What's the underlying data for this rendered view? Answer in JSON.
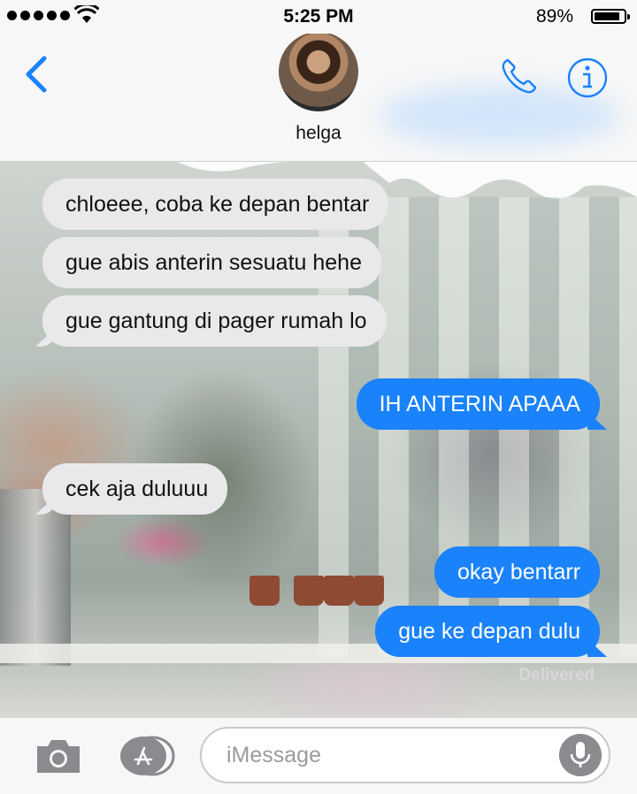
{
  "status_bar": {
    "time": "5:25 PM",
    "battery_percent": "89%",
    "signal_bars": 5,
    "wifi_icon": "wifi-icon"
  },
  "header": {
    "contact_name": "helga",
    "back_icon": "chevron-left-icon",
    "call_icon": "phone-icon",
    "info_icon": "info-icon"
  },
  "messages": [
    {
      "direction": "incoming",
      "text": "chloeee, coba ke depan bentar"
    },
    {
      "direction": "incoming",
      "text": "gue abis anterin sesuatu hehe"
    },
    {
      "direction": "incoming",
      "text": "gue gantung di pager rumah lo"
    },
    {
      "direction": "outgoing",
      "text": "IH ANTERIN APAAA"
    },
    {
      "direction": "incoming",
      "text": "cek aja duluuu"
    },
    {
      "direction": "outgoing",
      "text": "okay bentarr"
    },
    {
      "direction": "outgoing",
      "text": "gue ke depan dulu"
    }
  ],
  "delivery_status": "Delivered",
  "input_bar": {
    "placeholder": "iMessage",
    "camera_icon": "camera-icon",
    "apps_icon": "app-store-icon",
    "mic_icon": "microphone-icon"
  },
  "colors": {
    "accent": "#1a82fb",
    "incoming_bubble": "#e9e9eb",
    "bar_background": "#f7f7f7"
  }
}
